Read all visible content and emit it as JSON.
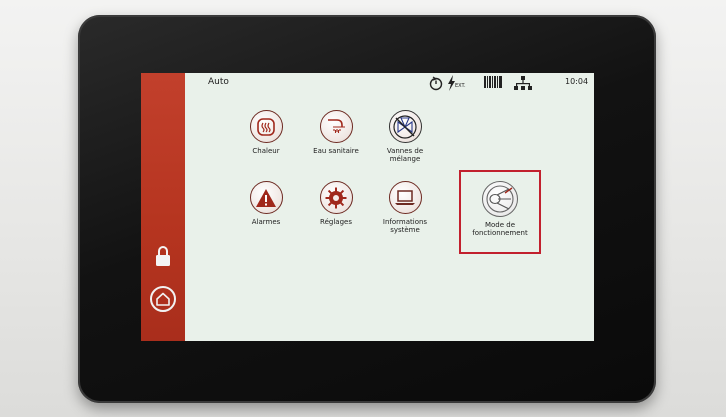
{
  "status_bar": {
    "mode": "Auto",
    "time": "10:04",
    "ext_label": "EXT."
  },
  "tiles": [
    {
      "label": "Chaleur",
      "icon": "heat-icon"
    },
    {
      "label": "Eau sanitaire",
      "icon": "shower-icon"
    },
    {
      "label": "Vannes de\nmélange",
      "icon": "mixing-valve-icon"
    },
    {
      "label": "Alarmes",
      "icon": "warning-icon"
    },
    {
      "label": "Réglages",
      "icon": "gear-icon"
    },
    {
      "label": "Informations\nsystème",
      "icon": "laptop-icon"
    },
    {
      "label": "Mode de\nfonctionnement",
      "icon": "operating-mode-icon"
    }
  ],
  "sidebar": {
    "lock_icon": "lock-icon",
    "home_icon": "home-icon"
  },
  "colors": {
    "sidebar": "#b5341f",
    "icon_accent": "#a0281c",
    "highlight": "#c2202e",
    "screen_bg": "#e9f1ea"
  }
}
